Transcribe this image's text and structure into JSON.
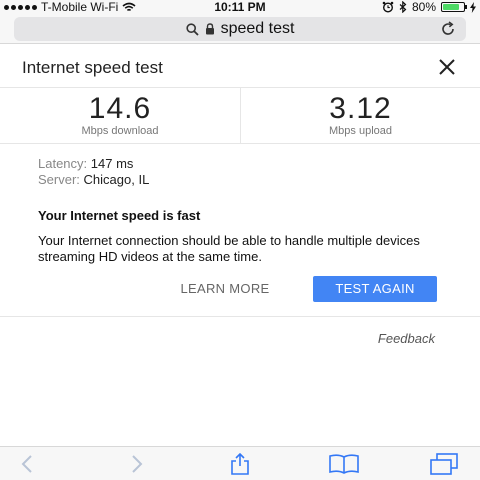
{
  "status": {
    "carrier": "T-Mobile Wi-Fi",
    "time": "10:11 PM",
    "battery": "80%",
    "battery_level": 0.8,
    "icons": [
      "signal-dots-icon",
      "wifi-icon",
      "alarm-icon",
      "bluetooth-icon",
      "battery-icon",
      "charging-icon"
    ]
  },
  "url_bar": {
    "query": "speed test",
    "icons": [
      "search-icon",
      "lock-icon",
      "reload-icon"
    ]
  },
  "card": {
    "title": "Internet speed test",
    "download": {
      "value": "14.6",
      "label": "Mbps download"
    },
    "upload": {
      "value": "3.12",
      "label": "Mbps upload"
    },
    "latency_label": "Latency:",
    "latency_value": "147 ms",
    "server_label": "Server:",
    "server_value": "Chicago, IL",
    "headline": "Your Internet speed is fast",
    "description": "Your Internet connection should be able to handle multiple devices streaming HD videos at the same time.",
    "learn_more": "LEARN MORE",
    "test_again": "TEST AGAIN",
    "feedback": "Feedback"
  },
  "toolbar": {
    "icons": [
      "back-icon",
      "forward-icon",
      "share-icon",
      "bookmarks-icon",
      "tabs-icon"
    ]
  },
  "colors": {
    "accent": "#4285f4",
    "battery": "#4cd964"
  }
}
